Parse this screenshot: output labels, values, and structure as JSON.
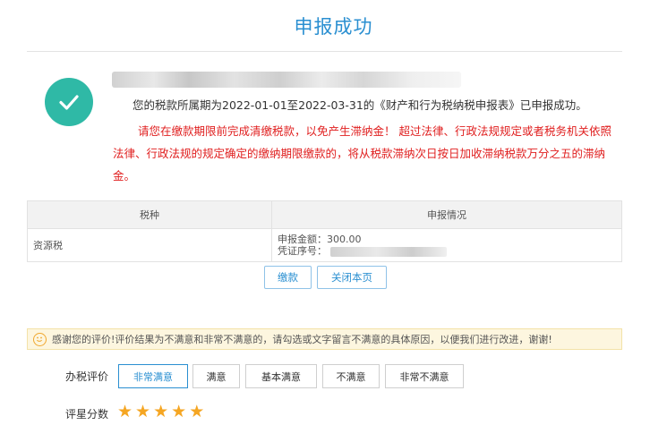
{
  "page": {
    "title": "申报成功"
  },
  "result": {
    "message": "您的税款所属期为2022-01-01至2022-03-31的《财产和行为税纳税申报表》已申报成功。",
    "warning": "请您在缴款期限前完成清缴税款，以免产生滞纳金！ 超过法律、行政法规规定或者税务机关依照法律、行政法规的规定确定的缴纳期限缴款的，将从税款滞纳次日按日加收滞纳税款万分之五的滞纳金。"
  },
  "table": {
    "headers": [
      "税种",
      "申报情况"
    ],
    "rows": [
      {
        "tax_type": "资源税",
        "amount_label": "申报金额：",
        "amount": "300.00",
        "voucher_label": "凭证序号："
      }
    ]
  },
  "actions": {
    "pay": "缴款",
    "close": "关闭本页"
  },
  "notice": {
    "text": "感谢您的评价!评价结果为不满意和非常不满意的，请勾选或文字留言不满意的具体原因，以便我们进行改进，谢谢!"
  },
  "rating": {
    "label": "办税评价",
    "options": [
      "非常满意",
      "满意",
      "基本满意",
      "不满意",
      "非常不满意"
    ],
    "selected": "非常满意",
    "score_label": "评星分数",
    "stars": 5,
    "max_stars": 5,
    "star_color": "#f5a623"
  },
  "colors": {
    "accent": "#2a8fd1",
    "success": "#2fb9a6",
    "warning": "#e02020"
  }
}
